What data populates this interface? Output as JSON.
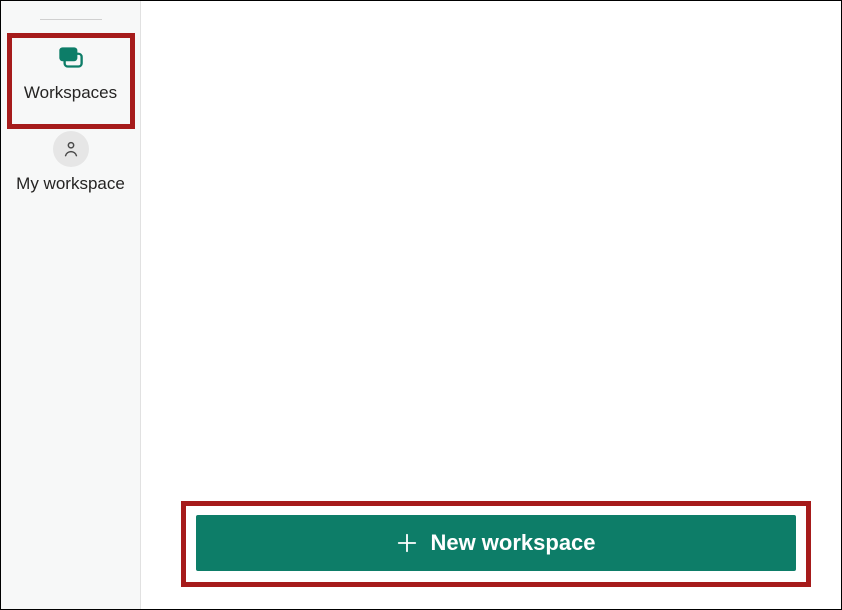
{
  "colors": {
    "accent": "#0d7d68",
    "sidebar_bg": "#f7f8f8",
    "highlight_border": "#a61b1b"
  },
  "sidebar": {
    "items": [
      {
        "id": "workspaces",
        "label": "Workspaces",
        "icon": "workspaces-icon"
      },
      {
        "id": "my-workspace",
        "label": "My workspace",
        "icon": "person-icon"
      }
    ]
  },
  "actions": {
    "new_workspace_label": "New workspace"
  }
}
